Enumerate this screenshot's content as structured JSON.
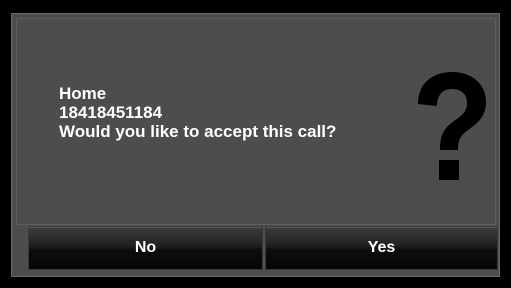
{
  "dialog": {
    "caller_name": "Home",
    "caller_number": "18418451184",
    "prompt": "Would you like to accept this call?",
    "icon": "question-mark-icon"
  },
  "buttons": {
    "no_label": "No",
    "yes_label": "Yes"
  },
  "colors": {
    "background": "#000000",
    "dialog": "#4d4d4d",
    "text": "#ffffff",
    "icon": "#000000"
  }
}
